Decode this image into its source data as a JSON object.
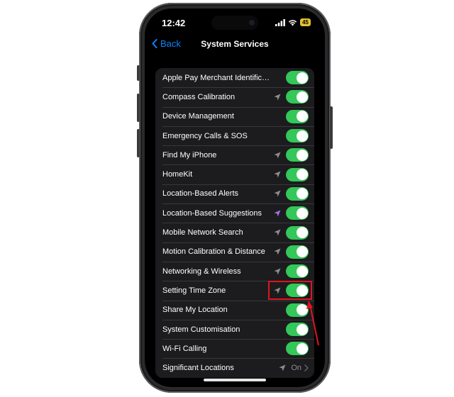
{
  "status_bar": {
    "time": "12:42",
    "battery": "45"
  },
  "nav": {
    "back_label": "Back",
    "title": "System Services"
  },
  "services": [
    {
      "label": "Apple Pay Merchant Identificati...",
      "arrow": "none",
      "state": "on"
    },
    {
      "label": "Compass Calibration",
      "arrow": "gray",
      "state": "on"
    },
    {
      "label": "Device Management",
      "arrow": "none",
      "state": "on"
    },
    {
      "label": "Emergency Calls & SOS",
      "arrow": "none",
      "state": "on"
    },
    {
      "label": "Find My iPhone",
      "arrow": "gray",
      "state": "on"
    },
    {
      "label": "HomeKit",
      "arrow": "gray",
      "state": "on"
    },
    {
      "label": "Location-Based Alerts",
      "arrow": "gray",
      "state": "on"
    },
    {
      "label": "Location-Based Suggestions",
      "arrow": "purple",
      "state": "on"
    },
    {
      "label": "Mobile Network Search",
      "arrow": "gray",
      "state": "on"
    },
    {
      "label": "Motion Calibration & Distance",
      "arrow": "gray",
      "state": "on"
    },
    {
      "label": "Networking & Wireless",
      "arrow": "gray",
      "state": "on"
    },
    {
      "label": "Setting Time Zone",
      "arrow": "gray",
      "state": "on"
    },
    {
      "label": "Share My Location",
      "arrow": "none",
      "state": "on"
    },
    {
      "label": "System Customisation",
      "arrow": "none",
      "state": "on"
    },
    {
      "label": "Wi-Fi Calling",
      "arrow": "none",
      "state": "on"
    }
  ],
  "significant_locations": {
    "label": "Significant Locations",
    "value": "On"
  },
  "colors": {
    "toggle_on": "#34c759",
    "accent": "#0a84ff",
    "arrow_gray": "#8e8e93",
    "arrow_purple": "#a66cf2",
    "annotation_red": "#e0141e"
  },
  "icons": {
    "back": "chevron-left-icon",
    "location": "location-arrow-icon",
    "chevron": "chevron-right-icon",
    "signal": "cellular-signal-icon",
    "wifi": "wifi-icon",
    "battery": "battery-icon"
  }
}
